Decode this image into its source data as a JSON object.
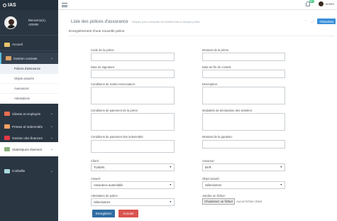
{
  "app": {
    "brand": "IAS"
  },
  "sidebar": {
    "profile": {
      "greeting": "Bienvenu(e),",
      "name": "ADMIN"
    },
    "items": [
      {
        "label": "Accueil",
        "icon": "home-icon",
        "color": "#e9c46a"
      },
      {
        "label": "Gestion contrats",
        "icon": "handshake-icon",
        "color": "#d9a066"
      },
      {
        "label": "Clients et employés",
        "icon": "users-icon",
        "color": "#e76f51"
      },
      {
        "label": "Primes et indemnités",
        "icon": "coins-icon",
        "color": "#f4a261"
      },
      {
        "label": "Gestion des finances",
        "icon": "finance-icon",
        "color": "#e63946"
      },
      {
        "label": "Statistiques diverses",
        "icon": "stats-icon",
        "color": "#8ab17d"
      },
      {
        "label": "Corbeille",
        "icon": "trash-icon",
        "color": "#a8dadc"
      }
    ],
    "sub_items": [
      "Polices d'assurance",
      "Objets assurés",
      "Avenances",
      "Attestations"
    ]
  },
  "topbar": {
    "notification_count": "99+",
    "user": "ADMIN"
  },
  "page": {
    "title": "Liste des polices d'assurance",
    "subtitle": "Cliquez pour consulter les fichiers liés à chaque police",
    "new_button": "+Nouveau",
    "section_title": "Enregistrement d'une nouvelle police"
  },
  "form": {
    "code_label": "Code de la police:",
    "prime_label": "Montant de la prime:",
    "signature_label": "Date de signature:",
    "end_label": "Date de fin de contrat:",
    "cancel_label": "Conditions de Sortie-renonciation:",
    "desc_label": "Description:",
    "payment_label": "Conditions de paiement de la prime:",
    "claims_label": "Modalités de déclaration des sinistres:",
    "indemn_label": "Conditions de paiement des indemnités:",
    "guarantee_label": "Montant de la garantie:",
    "client_label": "Client:",
    "client_value": "TUWAN",
    "insurer_label": "Assureur:",
    "insurer_value": "BVR",
    "insured_label": "Assuré:",
    "insured_value": "Assurance automobile",
    "object_label": "Objet assuré:",
    "object_value": "Sélectionner",
    "attestation_label": "Attestation de police:",
    "attestation_value": "Sélectionner",
    "file_label": "Joindre un fichier:",
    "file_button": "Choisissez un fichier",
    "file_status": "Aucun fichier choisi",
    "submit": "Enregistrer",
    "cancel": "Annuler"
  },
  "colors": {
    "sidebar": "#2b3643",
    "primary": "#2f6da3",
    "danger": "#d9534f",
    "accent": "#3a8fd9"
  }
}
